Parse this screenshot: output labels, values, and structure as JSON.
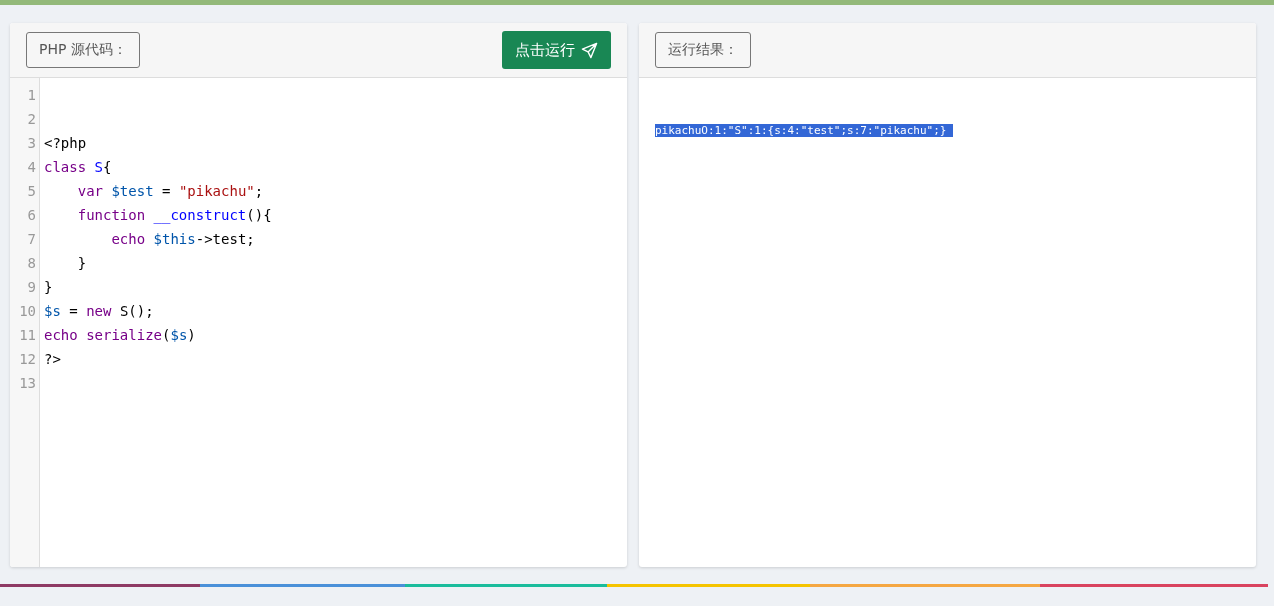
{
  "code_panel": {
    "label": "PHP 源代码：",
    "run_button": "点击运行",
    "lines": [
      {
        "number": "1"
      },
      {
        "number": "2"
      },
      {
        "number": "3",
        "tokens": [
          {
            "kind": "plain",
            "text": "<?php"
          }
        ]
      },
      {
        "number": "4",
        "tokens": [
          {
            "kind": "keyword",
            "text": "class"
          },
          {
            "kind": "name",
            "text": " S"
          },
          {
            "kind": "plain",
            "text": "{"
          }
        ]
      },
      {
        "number": "5",
        "tokens": [
          {
            "kind": "keyword",
            "text": "    var"
          },
          {
            "kind": "variable",
            "text": " $test"
          },
          {
            "kind": "plain",
            "text": " = "
          },
          {
            "kind": "string",
            "text": "\"pikachu\""
          },
          {
            "kind": "plain",
            "text": ";"
          }
        ]
      },
      {
        "number": "6",
        "tokens": [
          {
            "kind": "keyword",
            "text": "    function"
          },
          {
            "kind": "name",
            "text": " __construct"
          },
          {
            "kind": "plain",
            "text": "(){"
          }
        ]
      },
      {
        "number": "7",
        "tokens": [
          {
            "kind": "keyword",
            "text": "        echo"
          },
          {
            "kind": "variable",
            "text": " $this"
          },
          {
            "kind": "plain",
            "text": "->test;"
          }
        ]
      },
      {
        "number": "8",
        "tokens": [
          {
            "kind": "plain",
            "text": "    }"
          }
        ]
      },
      {
        "number": "9",
        "tokens": [
          {
            "kind": "plain",
            "text": "}"
          }
        ]
      },
      {
        "number": "10",
        "tokens": [
          {
            "kind": "variable",
            "text": "$s"
          },
          {
            "kind": "plain",
            "text": " = "
          },
          {
            "kind": "keyword",
            "text": "new"
          },
          {
            "kind": "plain",
            "text": " S();"
          }
        ]
      },
      {
        "number": "11",
        "tokens": [
          {
            "kind": "keyword",
            "text": "echo"
          },
          {
            "kind": "keyword",
            "text": " serialize"
          },
          {
            "kind": "plain",
            "text": "("
          },
          {
            "kind": "variable",
            "text": "$s"
          },
          {
            "kind": "plain",
            "text": ")"
          }
        ]
      },
      {
        "number": "12",
        "tokens": [
          {
            "kind": "plain",
            "text": "?>"
          }
        ]
      },
      {
        "number": "13"
      }
    ]
  },
  "result_panel": {
    "label": "运行结果：",
    "output": {
      "text": "pikachuO:1:\"S\":1:{s:4:\"test\";s:7:\"pikachu\";} ",
      "selected": true
    }
  }
}
